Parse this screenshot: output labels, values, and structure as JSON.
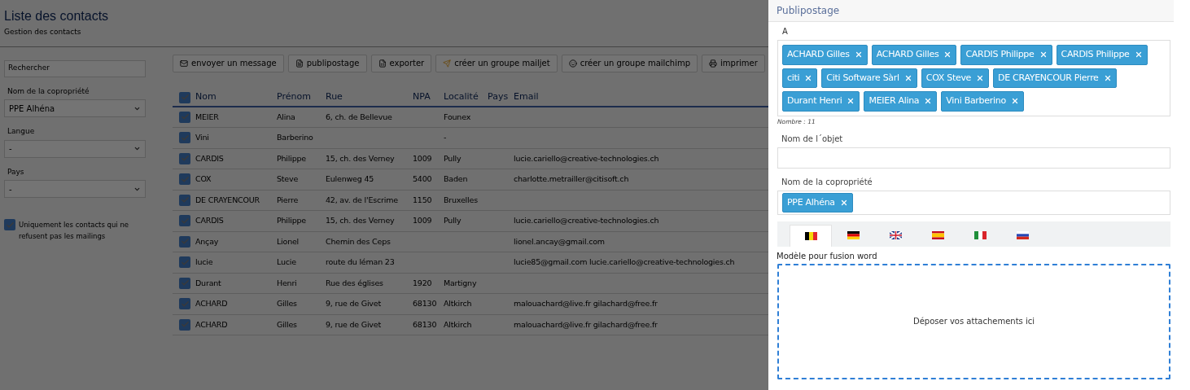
{
  "page": {
    "title": "Liste des contacts",
    "subtitle": "Gestion des contacts"
  },
  "filters": {
    "search": {
      "placeholder": "Rechercher"
    },
    "selects": [
      {
        "label": "Nom de la copropriété",
        "value": "PPE Alhéna"
      },
      {
        "label": "Langue",
        "value": "-"
      },
      {
        "label": "Pays",
        "value": "-"
      }
    ],
    "only_mailings": {
      "label": "Uniquement les contacts qui ne refusent pas les mailings",
      "checked": true
    }
  },
  "toolbar": [
    {
      "label": "envoyer un message",
      "kind": "envelope"
    },
    {
      "label": "publipostage",
      "kind": "file"
    },
    {
      "label": "exporter",
      "kind": "excel"
    },
    {
      "label": "créer un groupe mailjet",
      "kind": "plane"
    },
    {
      "label": "créer un groupe mailchimp",
      "kind": "chimp"
    },
    {
      "label": "imprimer",
      "kind": "printer"
    }
  ],
  "table": {
    "all_checked": true,
    "columns": [
      "Nom",
      "Prénom",
      "Rue",
      "NPA",
      "Localité",
      "Pays",
      "Email"
    ],
    "rows": [
      {
        "checked": true,
        "cells": [
          "MEIER",
          "Alina",
          "6, ch. de Bellevue",
          "",
          "Founex",
          "",
          ""
        ]
      },
      {
        "checked": true,
        "cells": [
          "Vini",
          "Barberino",
          "",
          "",
          "-",
          "",
          ""
        ]
      },
      {
        "checked": true,
        "cells": [
          "CARDIS",
          "Philippe",
          "15, ch. des Verney",
          "1009",
          "Pully",
          "",
          "lucie.cariello@creative-technologies.ch"
        ]
      },
      {
        "checked": true,
        "cells": [
          "COX",
          "Steve",
          "Eulenweg 45",
          "5400",
          "Baden",
          "",
          "charlotte.metrailler@citisoft.ch"
        ]
      },
      {
        "checked": true,
        "cells": [
          "DE CRAYENCOUR",
          "Pierre",
          "42, av. de l'Escrime",
          "1150",
          "Bruxelles",
          "",
          ""
        ]
      },
      {
        "checked": true,
        "cells": [
          "CARDIS",
          "Philippe",
          "15, ch. des Verney",
          "1009",
          "Pully",
          "",
          "lucie.cariello@creative-technologies.ch"
        ]
      },
      {
        "checked": true,
        "cells": [
          "Ançay",
          "Lionel",
          "Chemin des Ceps",
          "",
          "",
          "",
          "lionel.ancay@gmail.com"
        ]
      },
      {
        "checked": true,
        "cells": [
          "lucie",
          "Lucie",
          "route du léman 23",
          "",
          "",
          "",
          "lucie85@gmail.com lucie.cariello@creative-technologies.ch"
        ]
      },
      {
        "checked": true,
        "cells": [
          "Durant",
          "Henri",
          "Rue des églises",
          "1920",
          "Martigny",
          "",
          ""
        ]
      },
      {
        "checked": true,
        "cells": [
          "ACHARD",
          "Gilles",
          "9, rue de Givet",
          "68130",
          "Altkirch",
          "",
          "malouachard@live.fr gilachard@free.fr"
        ]
      },
      {
        "checked": true,
        "cells": [
          "ACHARD",
          "Gilles",
          "9, rue de Givet",
          "68130",
          "Altkirch",
          "",
          "malouachard@live.fr gilachard@free.fr"
        ]
      }
    ]
  },
  "panel": {
    "title": "Publipostage",
    "to": {
      "label": "A",
      "tags": [
        "ACHARD Gilles",
        "ACHARD Gilles",
        "CARDIS Philippe",
        "CARDIS Philippe",
        "citi",
        "Citi Software Sàrl",
        "COX Steve",
        "DE CRAYENCOUR Pierre",
        "Durant Henri",
        "MEIER Alina",
        "Vini Barberino"
      ],
      "count": "Nombre : 11"
    },
    "subject": {
      "label": "Nom de l´objet"
    },
    "property": {
      "label": "Nom de la copropriété",
      "tags": [
        "PPE Alhéna"
      ]
    },
    "flags": [
      {
        "kind": "be",
        "selected": true
      },
      {
        "kind": "de",
        "selected": false
      },
      {
        "kind": "gb",
        "selected": false
      },
      {
        "kind": "es",
        "selected": false
      },
      {
        "kind": "it",
        "selected": false
      },
      {
        "kind": "ru",
        "selected": false
      }
    ],
    "template": {
      "label": "Modèle pour fusion word",
      "dropzone": "Déposer vos attachements ici"
    }
  }
}
